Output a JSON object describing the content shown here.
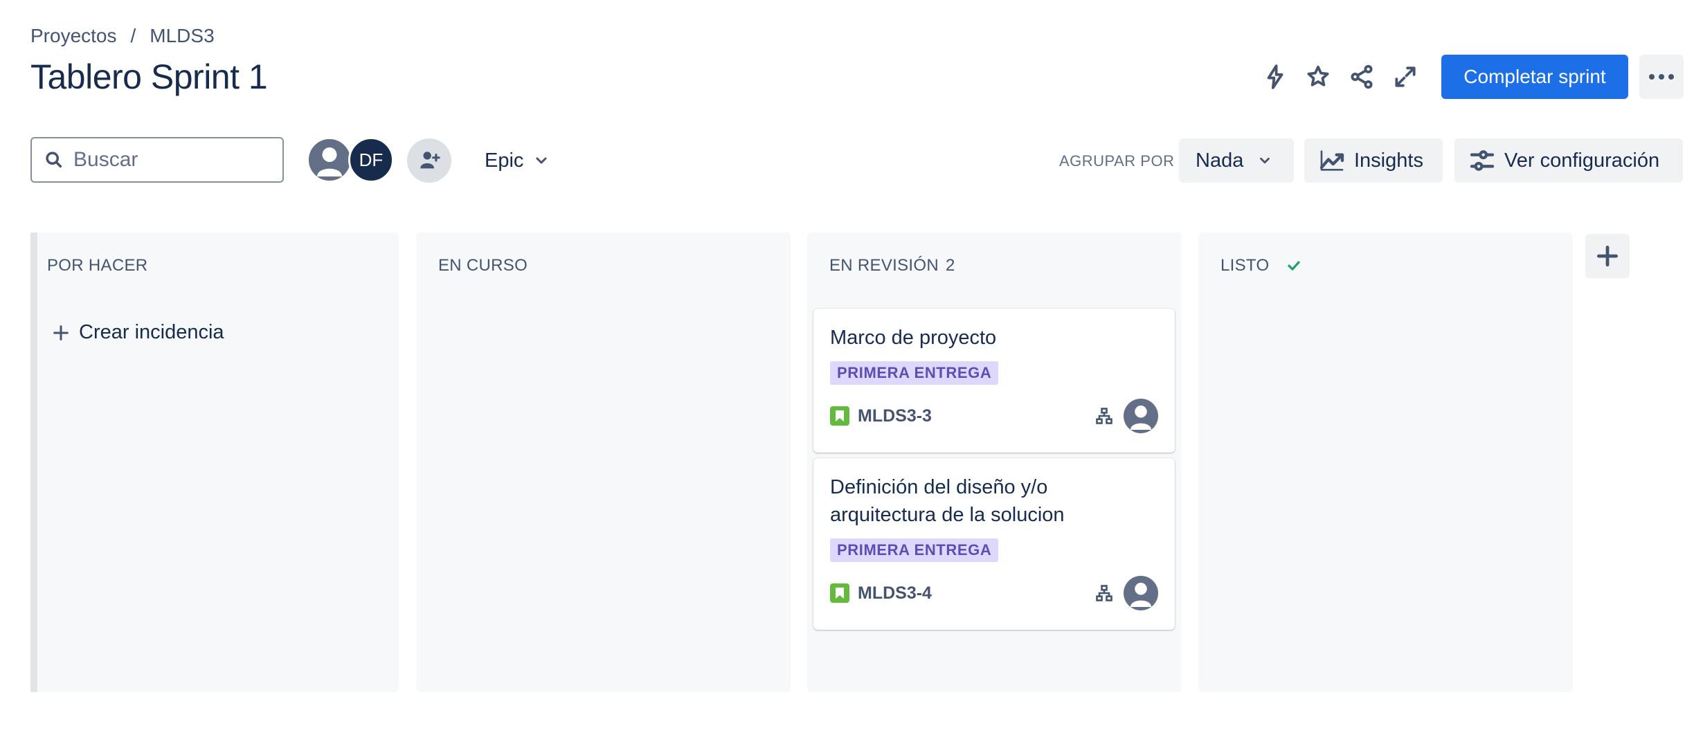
{
  "breadcrumb": {
    "projects": "Proyectos",
    "separator": "/",
    "project": "MLDS3"
  },
  "header": {
    "title": "Tablero Sprint 1",
    "complete_sprint_label": "Completar sprint"
  },
  "toolbar": {
    "search_placeholder": "Buscar",
    "avatar_initials": "DF",
    "epic_filter": "Epic",
    "group_by_label": "AGRUPAR POR",
    "group_by_value": "Nada",
    "insights_label": "Insights",
    "settings_label": "Ver configuración"
  },
  "columns": [
    {
      "title": "POR HACER",
      "count": "",
      "create_label": "Crear incidencia"
    },
    {
      "title": "EN CURSO",
      "count": ""
    },
    {
      "title": "EN REVISIÓN",
      "count": "2"
    },
    {
      "title": "LISTO",
      "count": ""
    }
  ],
  "cards": [
    {
      "title": "Marco de proyecto",
      "epic": "PRIMERA ENTREGA",
      "key": "MLDS3-3"
    },
    {
      "title": "Definición del diseño y/o arquitectura de la solucion",
      "epic": "PRIMERA ENTREGA",
      "key": "MLDS3-4"
    }
  ],
  "colors": {
    "primary": "#1D6FE8",
    "epic_bg": "#DFD8FD",
    "epic_text": "#5E4DB2",
    "story": "#63BA3C",
    "done_check": "#22A06B"
  }
}
